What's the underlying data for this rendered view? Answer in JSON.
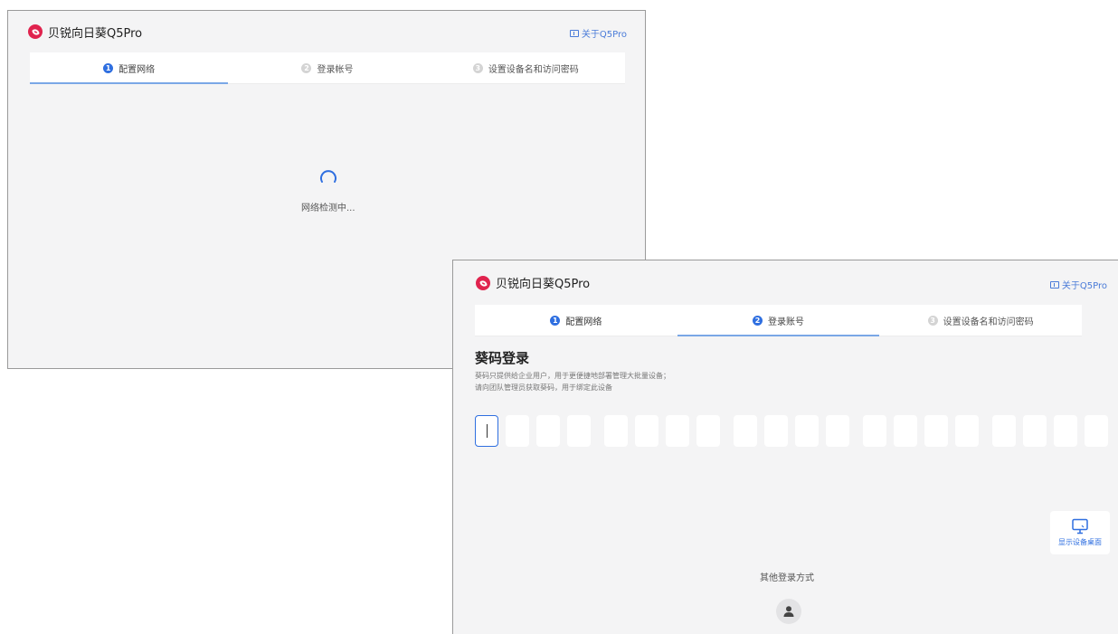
{
  "app": {
    "title": "贝锐向日葵Q5Pro",
    "about": "关于Q5Pro"
  },
  "steps": [
    {
      "num": "1",
      "label": "配置网络"
    },
    {
      "num": "2",
      "label": "登录帐号"
    },
    {
      "num": "3",
      "label": "设置设备名和访问密码"
    }
  ],
  "steps_w2": [
    {
      "num": "1",
      "label": "配置网络"
    },
    {
      "num": "2",
      "label": "登录账号"
    },
    {
      "num": "3",
      "label": "设置设备名和访问密码"
    }
  ],
  "window1": {
    "loading_text": "网络检测中..."
  },
  "window2": {
    "section_title": "葵码登录",
    "desc_line1": "葵码只提供给企业用户，用于更便捷地部署管理大批量设备；",
    "desc_line2": "请向团队管理员获取葵码，用于绑定此设备",
    "code_length": 20,
    "show_desktop_label": "显示设备桌面",
    "other_login_label": "其他登录方式"
  },
  "colors": {
    "accent": "#2f6fe0",
    "brand": "#e0234e",
    "link": "#4a7bd8"
  }
}
